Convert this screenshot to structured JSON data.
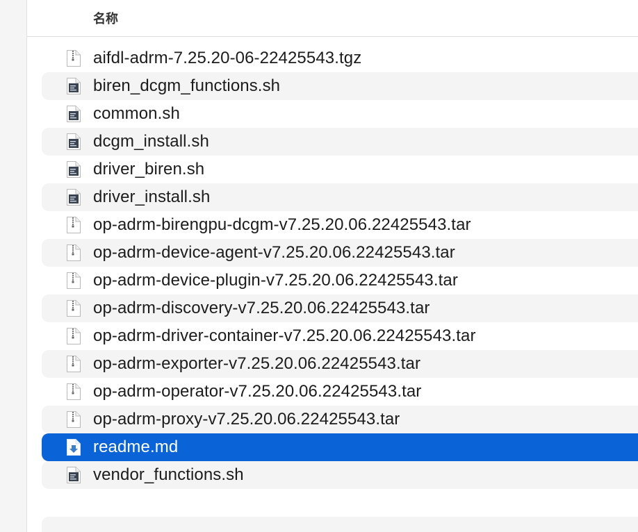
{
  "header": {
    "name_column": "名称"
  },
  "files": [
    {
      "name": "aifdl-adrm-7.25.20-06-22425543.tgz",
      "icon": "archive-file-icon",
      "selected": false
    },
    {
      "name": "biren_dcgm_functions.sh",
      "icon": "script-file-icon",
      "selected": false
    },
    {
      "name": "common.sh",
      "icon": "script-file-icon",
      "selected": false
    },
    {
      "name": "dcgm_install.sh",
      "icon": "script-file-icon",
      "selected": false
    },
    {
      "name": "driver_biren.sh",
      "icon": "script-file-icon",
      "selected": false
    },
    {
      "name": "driver_install.sh",
      "icon": "script-file-icon",
      "selected": false
    },
    {
      "name": "op-adrm-birengpu-dcgm-v7.25.20.06.22425543.tar",
      "icon": "archive-file-icon",
      "selected": false
    },
    {
      "name": "op-adrm-device-agent-v7.25.20.06.22425543.tar",
      "icon": "archive-file-icon",
      "selected": false
    },
    {
      "name": "op-adrm-device-plugin-v7.25.20.06.22425543.tar",
      "icon": "archive-file-icon",
      "selected": false
    },
    {
      "name": "op-adrm-discovery-v7.25.20.06.22425543.tar",
      "icon": "archive-file-icon",
      "selected": false
    },
    {
      "name": "op-adrm-driver-container-v7.25.20.06.22425543.tar",
      "icon": "archive-file-icon",
      "selected": false
    },
    {
      "name": "op-adrm-exporter-v7.25.20.06.22425543.tar",
      "icon": "archive-file-icon",
      "selected": false
    },
    {
      "name": "op-adrm-operator-v7.25.20.06.22425543.tar",
      "icon": "archive-file-icon",
      "selected": false
    },
    {
      "name": "op-adrm-proxy-v7.25.20.06.22425543.tar",
      "icon": "archive-file-icon",
      "selected": false
    },
    {
      "name": "readme.md",
      "icon": "markdown-file-icon",
      "selected": true
    },
    {
      "name": "vendor_functions.sh",
      "icon": "script-file-icon",
      "selected": false
    }
  ],
  "colors": {
    "selection": "#0a64d8",
    "stripe": "#f4f4f4"
  }
}
